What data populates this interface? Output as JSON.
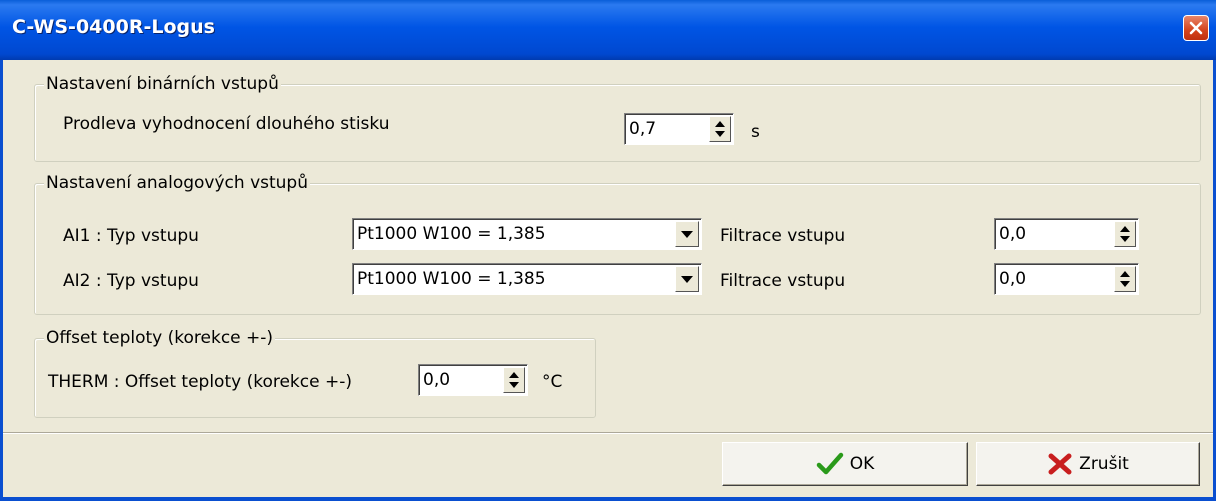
{
  "window": {
    "title": "C-WS-0400R-Logus"
  },
  "binary_inputs": {
    "legend": "Nastavení binárních vstupů",
    "delay_label": "Prodleva vyhodnocení dlouhého stisku",
    "delay_value": "0,7",
    "delay_unit": "s"
  },
  "analog_inputs": {
    "legend": "Nastavení analogových vstupů",
    "rows": [
      {
        "type_label": "AI1 : Typ vstupu",
        "type_value": "Pt1000 W100 = 1,385",
        "filter_label": "Filtrace vstupu",
        "filter_value": "0,0"
      },
      {
        "type_label": "AI2 : Typ vstupu",
        "type_value": "Pt1000 W100 = 1,385",
        "filter_label": "Filtrace vstupu",
        "filter_value": "0,0"
      }
    ]
  },
  "offset": {
    "legend": "Offset teploty (korekce +-)",
    "label": "THERM : Offset teploty (korekce +-)",
    "value": "0,0",
    "unit": "°C"
  },
  "buttons": {
    "ok": "OK",
    "cancel": "Zrušit"
  },
  "icons": {
    "close": "close-icon",
    "ok": "checkmark-icon",
    "cancel": "red-x-icon",
    "spin": "spin-arrows-icon",
    "dropdown": "chevron-down-icon"
  },
  "colors": {
    "titlebar": "#0055e5",
    "close": "#d4431c",
    "ok_check": "#2a9a1a",
    "cancel_x": "#c81e1e"
  }
}
